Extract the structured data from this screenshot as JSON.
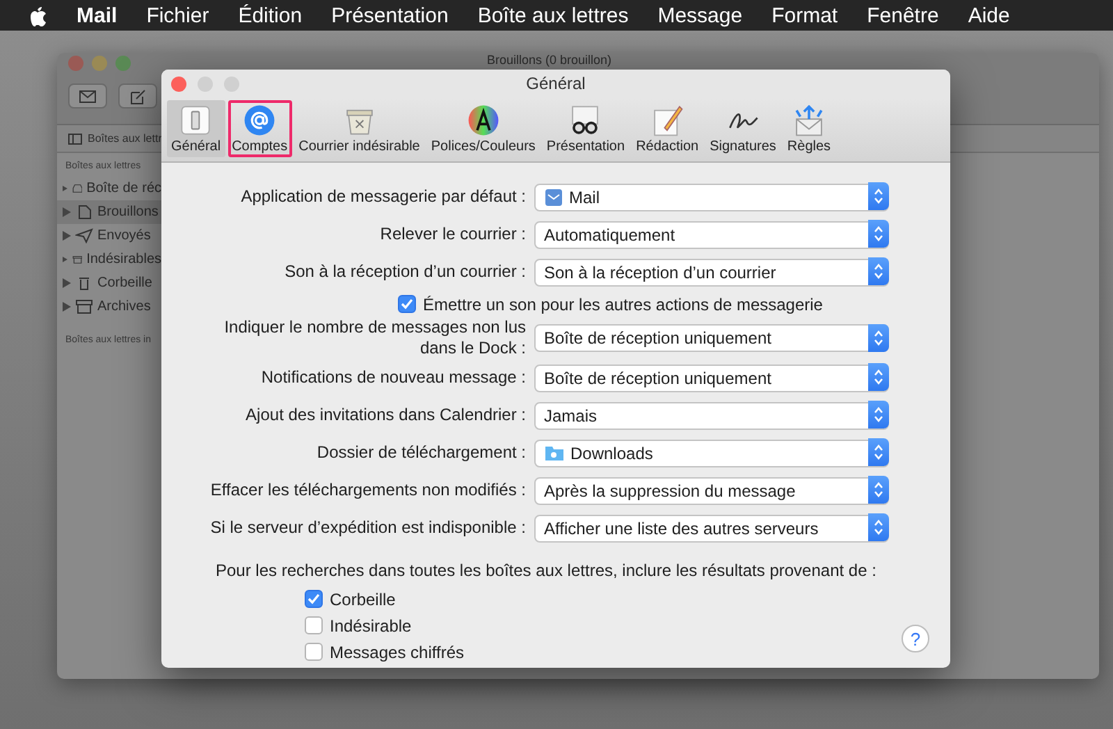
{
  "menu_bar": {
    "app": "Mail",
    "items": [
      "Fichier",
      "Édition",
      "Présentation",
      "Boîte aux lettres",
      "Message",
      "Format",
      "Fenêtre",
      "Aide"
    ]
  },
  "background_window": {
    "title": "Brouillons (0 brouillon)",
    "sidebar_toggle": "Boîtes aux lettr",
    "section": "Boîtes aux lettres",
    "mailboxes": [
      {
        "name": "Boîte de réc",
        "kind": "inbox",
        "selected": false
      },
      {
        "name": "Brouillons",
        "kind": "drafts",
        "selected": true
      },
      {
        "name": "Envoyés",
        "kind": "sent",
        "selected": false
      },
      {
        "name": "Indésirables",
        "kind": "junk",
        "selected": false
      },
      {
        "name": "Corbeille",
        "kind": "trash",
        "selected": false
      },
      {
        "name": "Archives",
        "kind": "archive",
        "selected": false
      }
    ],
    "section_2": "Boîtes aux lettres in"
  },
  "window": {
    "title": "Général"
  },
  "toolbar": [
    {
      "label": "Général",
      "kind": "general",
      "selected": true,
      "highlighted": false
    },
    {
      "label": "Comptes",
      "kind": "accounts",
      "selected": false,
      "highlighted": true
    },
    {
      "label": "Courrier indésirable",
      "kind": "junk",
      "selected": false,
      "highlighted": false
    },
    {
      "label": "Polices/Couleurs",
      "kind": "fonts",
      "selected": false,
      "highlighted": false
    },
    {
      "label": "Présentation",
      "kind": "viewing",
      "selected": false,
      "highlighted": false
    },
    {
      "label": "Rédaction",
      "kind": "composing",
      "selected": false,
      "highlighted": false
    },
    {
      "label": "Signatures",
      "kind": "signatures",
      "selected": false,
      "highlighted": false
    },
    {
      "label": "Règles",
      "kind": "rules",
      "selected": false,
      "highlighted": false
    }
  ],
  "settings": [
    {
      "kind": "app_popup",
      "label": "Application de messagerie par défaut :",
      "value": "Mail"
    },
    {
      "kind": "popup",
      "label": "Relever le courrier :",
      "value": "Automatiquement"
    },
    {
      "kind": "popup",
      "label": "Son à la réception d’un courrier :",
      "value": "Son à la réception d’un courrier"
    },
    {
      "kind": "checkbox",
      "label": "Émettre un son pour les autres actions de messagerie",
      "checked": true
    },
    {
      "kind": "popup",
      "label": "Indiquer le nombre de messages non lus\ndans le Dock :",
      "value": "Boîte de réception uniquement"
    },
    {
      "kind": "popup",
      "label": "Notifications de nouveau message :",
      "value": "Boîte de réception uniquement"
    },
    {
      "kind": "popup",
      "label": "Ajout des invitations dans Calendrier :",
      "value": "Jamais"
    },
    {
      "kind": "folder_popup",
      "label": "Dossier de téléchargement :",
      "value": "Downloads"
    },
    {
      "kind": "popup",
      "label": "Effacer les téléchargements non modifiés :",
      "value": "Après la suppression du message"
    },
    {
      "kind": "popup",
      "label": "Si le serveur d’expédition est indisponible :",
      "value": "Afficher une liste des autres serveurs"
    }
  ],
  "search_include": {
    "label": "Pour les recherches dans toutes les boîtes aux lettres, inclure les résultats provenant de :",
    "options": [
      {
        "label": "Corbeille",
        "checked": true
      },
      {
        "label": "Indésirable",
        "checked": false
      },
      {
        "label": "Messages chiffrés",
        "checked": false
      }
    ]
  },
  "help": "?"
}
